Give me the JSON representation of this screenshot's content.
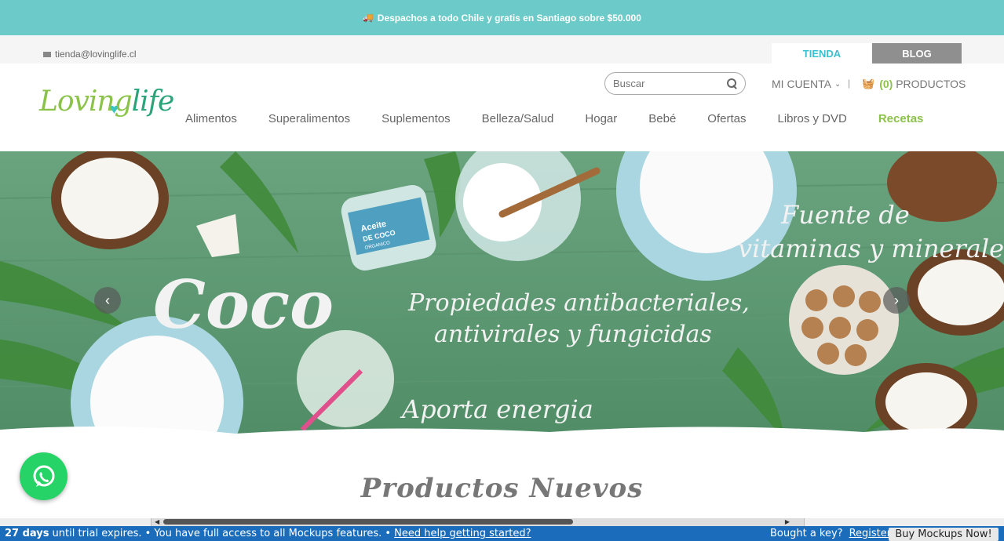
{
  "topbar": {
    "message": "Despachos a todo Chile y gratis en Santiago sobre $50.000"
  },
  "util": {
    "email": "tienda@lovinglife.cl",
    "tab_store": "TIENDA",
    "tab_blog": "BLOG"
  },
  "header": {
    "logo_loving": "Loving",
    "logo_life": "life",
    "search_placeholder": "Buscar",
    "account_label": "MI CUENTA",
    "separator": "|",
    "cart_count": "(0)",
    "cart_label": "PRODUCTOS"
  },
  "nav": {
    "items": [
      "Alimentos",
      "Superalimentos",
      "Suplementos",
      "Belleza/Salud",
      "Hogar",
      "Bebé",
      "Ofertas",
      "Libros y DVD",
      "Recetas"
    ]
  },
  "hero": {
    "title": "Coco",
    "line1": "Propiedades antibacteriales,",
    "line2": "antivirales y fungicidas",
    "line3": "Fuente de",
    "line4": "vitaminas y minerales",
    "line5": "Aporta energia",
    "jar_label1": "Aceite",
    "jar_label2": "DE COCO",
    "jar_label3": "ORGANICO",
    "background_color": "#5e9a72"
  },
  "content": {
    "section_title": "Productos Nuevos"
  },
  "trial": {
    "days": "27 days",
    "message": "until trial expires. • You have full access to all Mockups features. •",
    "help_link": "Need help getting started?",
    "key_text": "Bought a key?",
    "register_link": "Register...",
    "buy_button": "Buy Mockups Now!"
  },
  "colors": {
    "teal": "#6ccbc8",
    "green_accent": "#8bc34a",
    "trial_blue": "#1b6dbc",
    "whatsapp": "#25d366"
  }
}
